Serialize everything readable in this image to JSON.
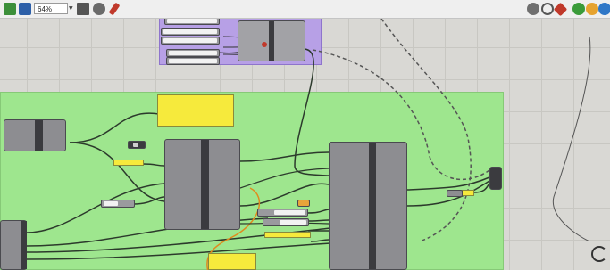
{
  "toolbar": {
    "zoom_value": "64%"
  },
  "icons": {
    "left": [
      "save-icon",
      "save-as-icon",
      "zoom-dropdown",
      "fit-view-icon",
      "preview-mode-icon",
      "paint-brush-icon"
    ],
    "right": [
      "preview-off-icon",
      "wireframe-icon",
      "shaded-icon",
      "material-icon",
      "colored-ball-icon",
      "sphere-icon"
    ]
  },
  "colors": {
    "canvas": "#d9d8d4",
    "group_green": "#9ee68e",
    "group_purple": "#b7a0e6",
    "component": "#8d8d91",
    "panel_yellow": "#f6ea3c",
    "wire": "#3e4a3e"
  },
  "canvas": {
    "groups": [
      {
        "name": "input-sliders-group",
        "color": "purple"
      },
      {
        "name": "main-logic-group",
        "color": "green"
      }
    ],
    "components": [
      {
        "name": "top-cluster-component",
        "label": ""
      },
      {
        "name": "left-small-component",
        "label": ""
      },
      {
        "name": "center-component",
        "label": ""
      },
      {
        "name": "right-main-component",
        "label": ""
      },
      {
        "name": "far-right-output-component",
        "label": ""
      },
      {
        "name": "bottom-left-component",
        "label": ""
      }
    ],
    "panels": [
      {
        "name": "top-yellow-panel",
        "text": ""
      },
      {
        "name": "bottom-yellow-panel",
        "text": ""
      }
    ]
  }
}
